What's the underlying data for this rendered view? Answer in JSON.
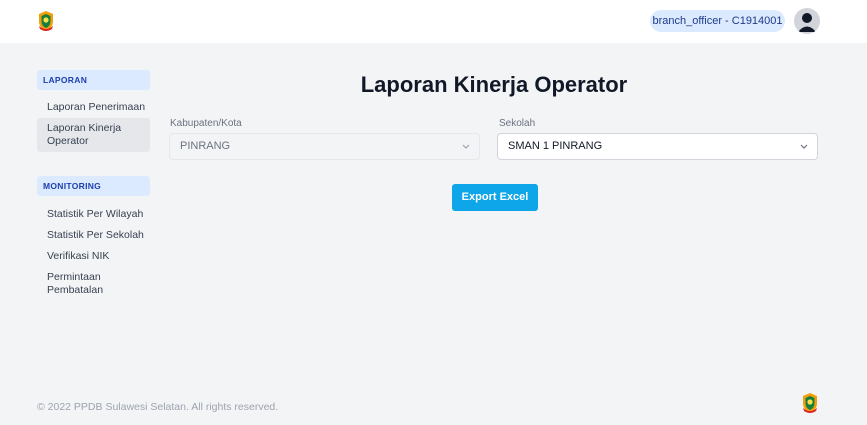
{
  "header": {
    "logo_icon": "provincial-emblem-icon",
    "user_label": "branch_officer - C1914001",
    "avatar_icon": "user-avatar-icon"
  },
  "sidebar": {
    "sections": [
      {
        "title": "LAPORAN",
        "items": [
          {
            "label": "Laporan Penerimaan",
            "active": false
          },
          {
            "label": "Laporan Kinerja Operator",
            "active": true
          }
        ]
      },
      {
        "title": "MONITORING",
        "items": [
          {
            "label": "Statistik Per Wilayah",
            "active": false
          },
          {
            "label": "Statistik Per Sekolah",
            "active": false
          },
          {
            "label": "Verifikasi NIK",
            "active": false
          },
          {
            "label": "Permintaan Pembatalan",
            "active": false
          }
        ]
      }
    ]
  },
  "main": {
    "title": "Laporan Kinerja Operator",
    "kabupaten": {
      "label": "Kabupaten/Kota",
      "value": "PINRANG",
      "disabled": true
    },
    "sekolah": {
      "label": "Sekolah",
      "value": "SMAN 1 PINRANG",
      "disabled": false
    },
    "export_label": "Export Excel"
  },
  "footer": {
    "copyright": "© 2022 PPDB Sulawesi Selatan. All rights reserved."
  },
  "colors": {
    "accent": "#0ea5e9",
    "badge_bg": "#dbeafe",
    "page_bg": "#f3f4f6"
  }
}
